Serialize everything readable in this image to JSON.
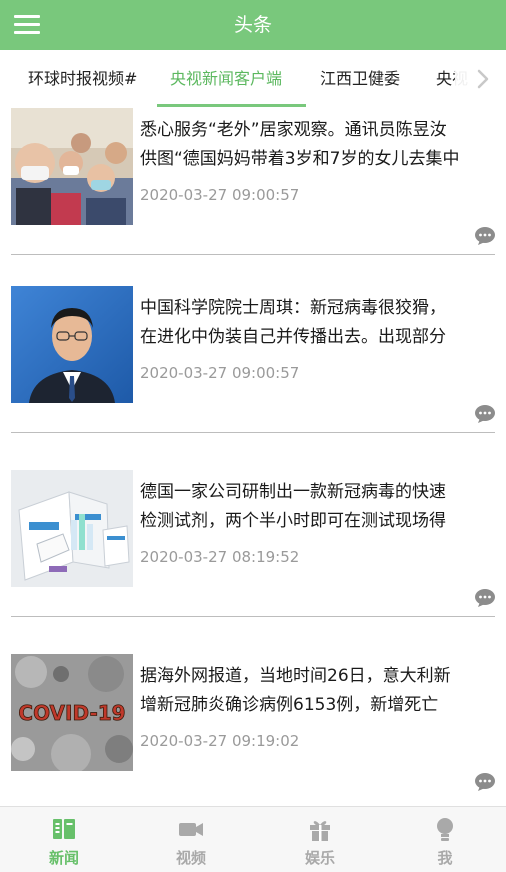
{
  "appbar": {
    "title": "头条"
  },
  "tabs": [
    {
      "label": "环球时报视频#",
      "active": false
    },
    {
      "label": "央视新闻客户端",
      "active": true
    },
    {
      "label": "江西卫健委",
      "active": false
    },
    {
      "label": "央视",
      "active": false
    }
  ],
  "news": [
    {
      "line1": "悉心服务“老外”居家观察。通讯员陈昱汝",
      "line2": "供图“德国妈妈带着3岁和7岁的女儿去集中",
      "time": "2020-03-27 09:00:57",
      "thumb_icon": "family-selfie-photo"
    },
    {
      "line1": "中国科学院院士周琪：新冠病毒很狡猾，",
      "line2": "在进化中伪装自己并传播出去。出现部分",
      "time": "2020-03-27 09:00:57",
      "thumb_icon": "scientist-portrait-photo"
    },
    {
      "line1": "德国一家公司研制出一款新冠病毒的快速",
      "line2": "检测试剂，两个半小时即可在测试现场得",
      "time": "2020-03-27 08:19:52",
      "thumb_icon": "test-kit-photo"
    },
    {
      "line1": "据海外网报道，当地时间26日，意大利新",
      "line2": "增新冠肺炎确诊病例6153例，新增死亡",
      "time": "2020-03-27 09:19:02",
      "thumb_icon": "covid-19-graphic",
      "thumb_text": "COVID-19"
    }
  ],
  "bottom_nav": [
    {
      "label": "新闻",
      "icon": "news-book-icon",
      "active": true
    },
    {
      "label": "视频",
      "icon": "video-camera-icon",
      "active": false
    },
    {
      "label": "娱乐",
      "icon": "gift-icon",
      "active": false
    },
    {
      "label": "我",
      "icon": "person-icon",
      "active": false
    }
  ],
  "colors": {
    "brand_green": "#79c87c",
    "active_tab_text": "#5cb85f",
    "timestamp": "#9a9a9a",
    "nav_inactive": "#a9a9a9"
  }
}
